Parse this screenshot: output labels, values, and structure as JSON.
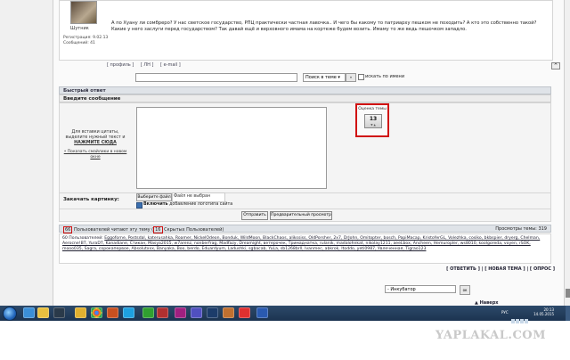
{
  "post": {
    "username": "Шутник",
    "reg_date": "Регистрация: 9.02.13",
    "messages": "Сообщений: 41",
    "text": "А по Хуану ли сомбреро? У нас светское государство, РПЦ практически частная лавочка.. И чего бы какому то патриарху пешком не походить? А кто это собственно такой? Какие у него заслуги перед государством? Так давай ещё и верховного имама на кортеже будем возить. Имаму то же ведь пешочком западло.",
    "links": [
      "[ профиль ]",
      "[ ЛН ]",
      "[ e-mail ]"
    ],
    "caret": "^"
  },
  "search": {
    "select": "Поиск в теме ▾",
    "go": "»",
    "checkbox_label": "искать по имени"
  },
  "quick_reply": {
    "title": "Быстрый ответ",
    "subtitle": "Введите сообщение",
    "hint": "Для вставки цитаты, выделите нужный текст и",
    "hint_bold": "НАЖМИТЕ СЮДА",
    "smiles": "• Показать смайлики в новом окне",
    "rating_label": "Оценка темы",
    "rating_value": "13",
    "rating_sub": "▼ ▲",
    "attach_label": "Закачать картинку:",
    "file_button": "Выберите файл",
    "file_none": "Файл не выбран",
    "logo_bold": "Включить",
    "logo_rest": " добавление логотипа сайта",
    "send": "Отправить",
    "preview": "Предварительный просмотр"
  },
  "online": {
    "total": "66",
    "text_mid": " Пользователей читают эту тему (",
    "hidden": "16",
    "text_end": " Скрытых Пользователей)",
    "views": "Просмотры темы: 319",
    "list_prefix": "60 Пользователей: ",
    "users": "Eggoforne, Postsdal, katerusahka, Roamer, NickelOdeon, Bonduk, WildMoon, BlackChaos, alikssiss, OldPorsher, 2x7, DrJohn, Omitopter, bosch, PapiMacap, KristoferGL, Volezhka, cosiko, bkbspier, dryerg, Chelman, Aerocne!BT, YuraDT, Kanadiane, Стикан, Masya2015, w7arenz, nonberfrag, Madfazy, Dreamight, ветерочек, Тримаднатка, rulanik, madalohnkat, nikolay1211, aeeLbox, Ancheen, Hemuropler, ws8010, koolgoreda, voyen, rSOK, mooo035, Sagra, сорокапервое, Absolutxxx, Banyaka, Boo, berdo, Eduardyum, Ladushki, sgbacab, YuLa, sb1268brll, Ivanmec, abkrok, Itoddo, yeti0987, Увлеченная, Tigrao123"
  },
  "bottom": {
    "actions": "[ ОТВЕТИТЬ ] | [ НОВАЯ ТЕМА ] | [ ОПРОС ]",
    "jump_select": "- Инкубатор",
    "jump_go": "ок",
    "nav_up": "▲ Наверх"
  },
  "taskbar": {
    "lang": "РУС",
    "time": "20:13",
    "date": "14.05.2015"
  },
  "watermark": "YAPLAKAL.COM"
}
